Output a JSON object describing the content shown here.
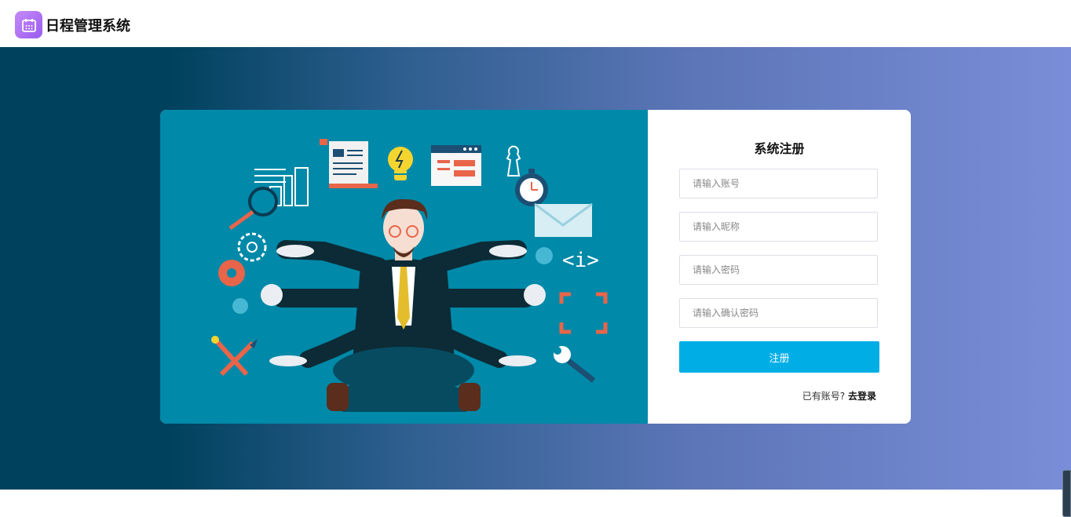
{
  "app": {
    "title": "日程管理系统",
    "logo_icon": "calendar-icon",
    "logo_color": "#b06ef5"
  },
  "register": {
    "title": "系统注册",
    "fields": {
      "account_placeholder": "请输入账号",
      "nickname_placeholder": "请输入昵称",
      "password_placeholder": "请输入密码",
      "confirm_placeholder": "请输入确认密码"
    },
    "submit_label": "注册",
    "have_account_text": "已有账号?",
    "login_link": "去登录",
    "accent_color": "#00aee6"
  },
  "illustration": {
    "background": "#0089a8",
    "subject": "multitasking-businessman-illustration"
  }
}
